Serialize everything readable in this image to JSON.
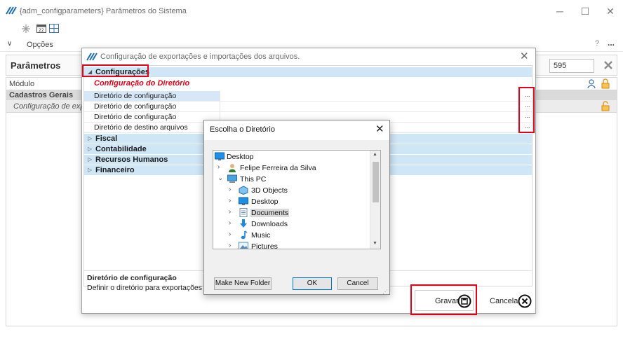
{
  "main_window": {
    "title": "{adm_configparameters} Parâmetros do Sistema",
    "options_label": "Opções",
    "params_title": "Parâmetros",
    "search_value": "595",
    "help_label": "?",
    "more_label": "...",
    "grid": {
      "column_header": "Módulo",
      "group_label": "Cadastros Gerais",
      "row_label": "Configuração de expo"
    }
  },
  "dialog": {
    "title": "Configuração de exportações e importações dos arquivos.",
    "categories": [
      {
        "label": "Configurações",
        "expanded": true
      },
      {
        "label": "Fiscal",
        "expanded": false
      },
      {
        "label": "Contabilidade",
        "expanded": false
      },
      {
        "label": "Recursos Humanos",
        "expanded": false
      },
      {
        "label": "Financeiro",
        "expanded": false
      }
    ],
    "subsection": "Configuração do Diretório",
    "properties": [
      {
        "name": "Diretório de configuração",
        "selected": true
      },
      {
        "name": "Diretório de configuração",
        "selected": false
      },
      {
        "name": "Diretório de configuração",
        "selected": false
      },
      {
        "name": "Diretório de destino arquivos",
        "selected": false
      }
    ],
    "ellipsis_label": "...",
    "description_title": "Diretório de configuração",
    "description_text": "Definir o diretório para exportações e",
    "save_label": "Gravar",
    "cancel_label": "Cancelar"
  },
  "folder_dialog": {
    "title": "Escolha o Diretório",
    "tree": [
      {
        "label": "Desktop",
        "icon": "desktop-icon",
        "chevron": "",
        "level": 0
      },
      {
        "label": "Felipe Ferreira da Silva",
        "icon": "user-icon",
        "chevron": ">",
        "level": 1
      },
      {
        "label": "This PC",
        "icon": "computer-icon",
        "chevron": "v",
        "level": 1
      },
      {
        "label": "3D Objects",
        "icon": "cube-icon",
        "chevron": ">",
        "level": 2
      },
      {
        "label": "Desktop",
        "icon": "desktop-icon",
        "chevron": ">",
        "level": 2
      },
      {
        "label": "Documents",
        "icon": "documents-icon",
        "chevron": ">",
        "level": 2,
        "selected": true
      },
      {
        "label": "Downloads",
        "icon": "download-icon",
        "chevron": ">",
        "level": 2
      },
      {
        "label": "Music",
        "icon": "music-icon",
        "chevron": ">",
        "level": 2
      },
      {
        "label": "Pictures",
        "icon": "pictures-icon",
        "chevron": ">",
        "level": 2
      }
    ],
    "make_folder_label": "Make New Folder",
    "ok_label": "OK",
    "cancel_label": "Cancel"
  },
  "colors": {
    "category_bg": "#cfe6f6",
    "subsection_text": "#e0001b",
    "highlight_box": "#e2001a",
    "grid_group_bg": "#dadada"
  }
}
